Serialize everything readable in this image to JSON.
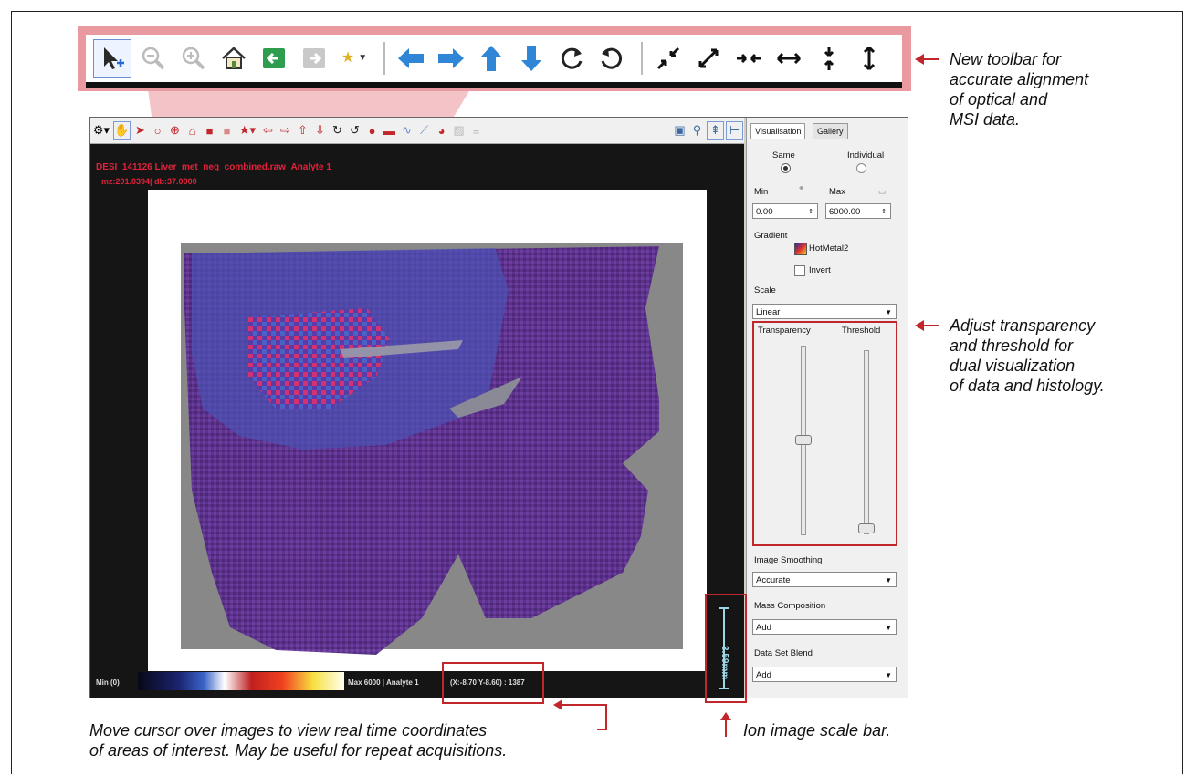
{
  "annotations": {
    "toolbar_note": [
      "New toolbar for",
      "accurate alignment",
      "of optical and",
      "MSI data."
    ],
    "transparency_note": [
      "Adjust transparency",
      "and threshold for",
      "dual visualization",
      "of data and histology."
    ],
    "cursor_note": [
      "Move cursor over images to view real time coordinates",
      "of areas of interest. May be useful for repeat acquisitions."
    ],
    "scalebar_note": "Ion image scale bar."
  },
  "big_toolbar": {
    "icons": [
      "select-cursor-icon",
      "zoom-out-icon",
      "zoom-in-icon",
      "home-icon",
      "back-icon",
      "forward-icon",
      "favorites-icon",
      "move-left-icon",
      "move-right-icon",
      "move-up-icon",
      "move-down-icon",
      "rotate-right-icon",
      "rotate-left-icon",
      "shrink-diagonal-icon",
      "expand-diagonal-icon",
      "shrink-horizontal-icon",
      "expand-horizontal-icon",
      "shrink-vertical-icon",
      "expand-vertical-icon"
    ]
  },
  "viewer": {
    "title": "DESI_141126 Liver_met_neg_combined.raw_Analyte 1",
    "subtitle": "mz:201.0394| db:37.0000",
    "colorbar_min": "Min (0)",
    "colorbar_max": "Max 6000 | Analyte 1",
    "coordinates": "(X:-8.70 Y-8.60) : 1387",
    "scale_bar_label": "3.59mm"
  },
  "panel": {
    "tabs": [
      "Visualisation",
      "Gallery"
    ],
    "same_label": "Same",
    "individual_label": "Individual",
    "min_label": "Min",
    "max_label": "Max",
    "min_value": "0.00",
    "max_value": "6000.00",
    "gradient_label": "Gradient",
    "gradient_value": "HotMetal2",
    "invert_label": "Invert",
    "scale_label": "Scale",
    "scale_value": "Linear",
    "transparency_label": "Transparency",
    "threshold_label": "Threshold",
    "transparency_level": 0.5,
    "threshold_level": 0.0,
    "smoothing_label": "Image Smoothing",
    "smoothing_value": "Accurate",
    "mass_label": "Mass Composition",
    "mass_value": "Add",
    "blend_label": "Data Set Blend",
    "blend_value": "Add"
  },
  "colors": {
    "callout_red": "#c0262c",
    "callout_fill": "#e89aa0",
    "arrow_blue": "#2f86d6"
  }
}
